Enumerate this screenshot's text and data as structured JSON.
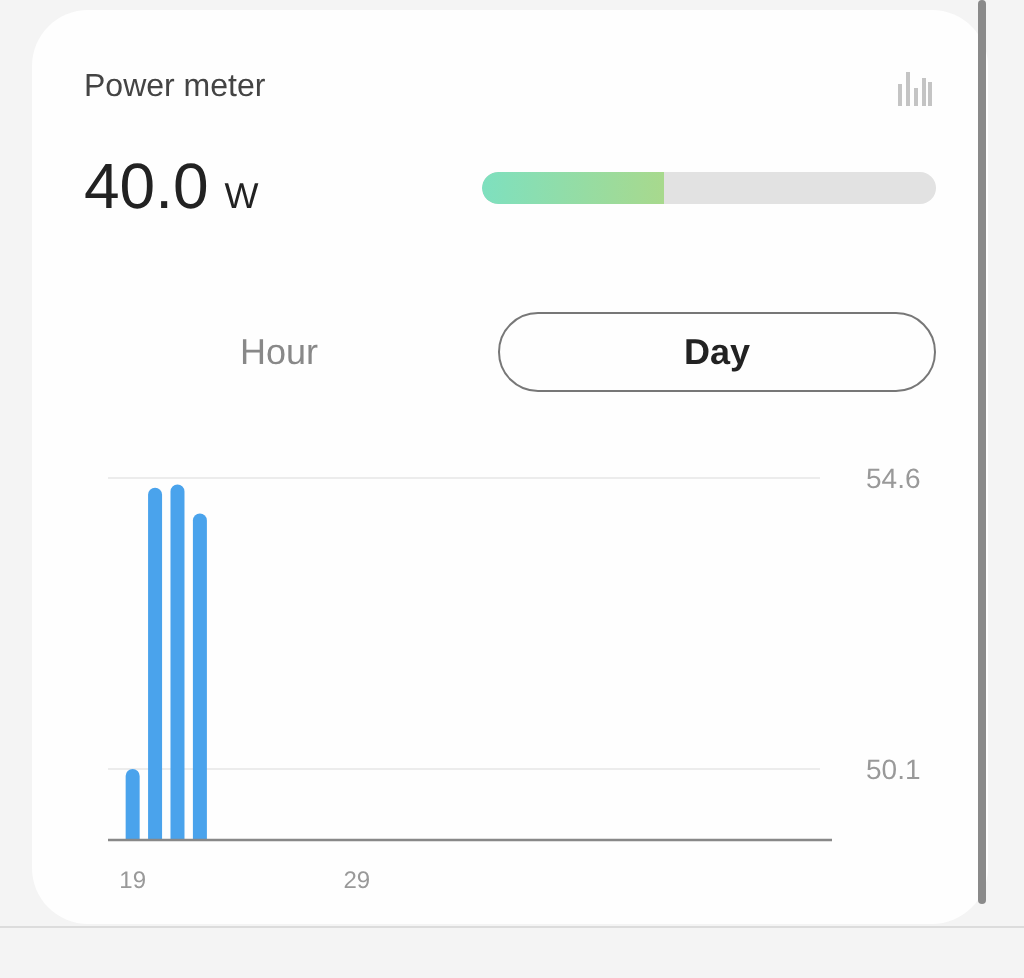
{
  "card": {
    "title": "Power meter",
    "value": "40.0",
    "unit": "W",
    "level": 0.4
  },
  "tabs": [
    {
      "label": "Hour",
      "selected": false
    },
    {
      "label": "Day",
      "selected": true
    }
  ],
  "chart_data": {
    "type": "bar",
    "x": [
      19,
      20,
      21,
      22
    ],
    "series": [
      {
        "color": "#4aa3ec",
        "values": [
          50.1,
          54.45,
          54.5,
          54.05
        ]
      }
    ],
    "xlim": [
      17.9,
      50.2
    ],
    "ylim": [
      49.0,
      54.6
    ],
    "yticks": [
      {
        "value": 50.1,
        "label": "50.1"
      },
      {
        "value": 54.6,
        "label": "54.6"
      }
    ],
    "xticks": [
      19,
      29
    ]
  }
}
